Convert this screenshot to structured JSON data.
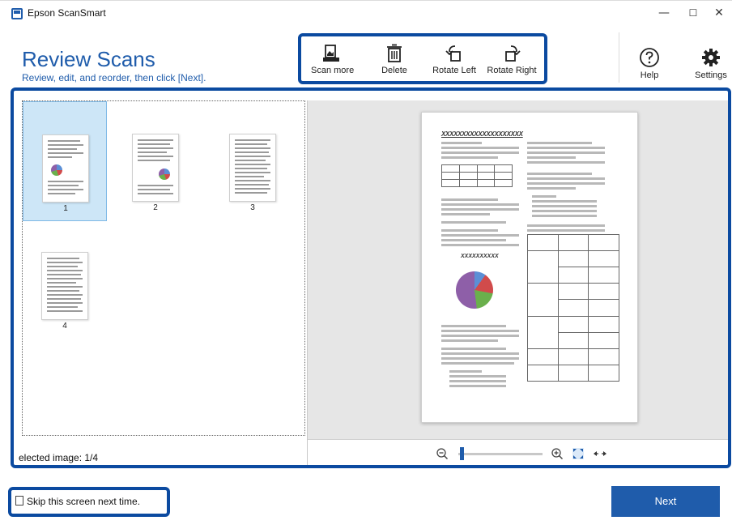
{
  "window": {
    "title": "Epson ScanSmart",
    "controls": {
      "minimize": "—",
      "maximize": "☐",
      "close": "✕"
    }
  },
  "header": {
    "title": "Review Scans",
    "subtitle": "Review, edit, and reorder, then click [Next]."
  },
  "toolbar": {
    "scan_more": "Scan more",
    "delete": "Delete",
    "rotate_left": "Rotate Left",
    "rotate_right": "Rotate Right",
    "help": "Help",
    "settings": "Settings"
  },
  "thumbnails": [
    {
      "label": "1",
      "selected": true
    },
    {
      "label": "2",
      "selected": false
    },
    {
      "label": "3",
      "selected": false
    },
    {
      "label": "4",
      "selected": false
    }
  ],
  "status": {
    "selected_image": "elected image: 1/4"
  },
  "preview": {
    "doc_title": "XXXXXXXXXXXXXXXXXXXX",
    "pie_label": "XXXXXXXXXX"
  },
  "zoom": {
    "level": 0.02
  },
  "footer": {
    "skip_label": "Skip this screen next time.",
    "skip_checked": false,
    "next_label": "Next"
  },
  "colors": {
    "accent": "#1f5cab",
    "highlight": "#0b4aa0",
    "selection": "#cde6f7"
  }
}
